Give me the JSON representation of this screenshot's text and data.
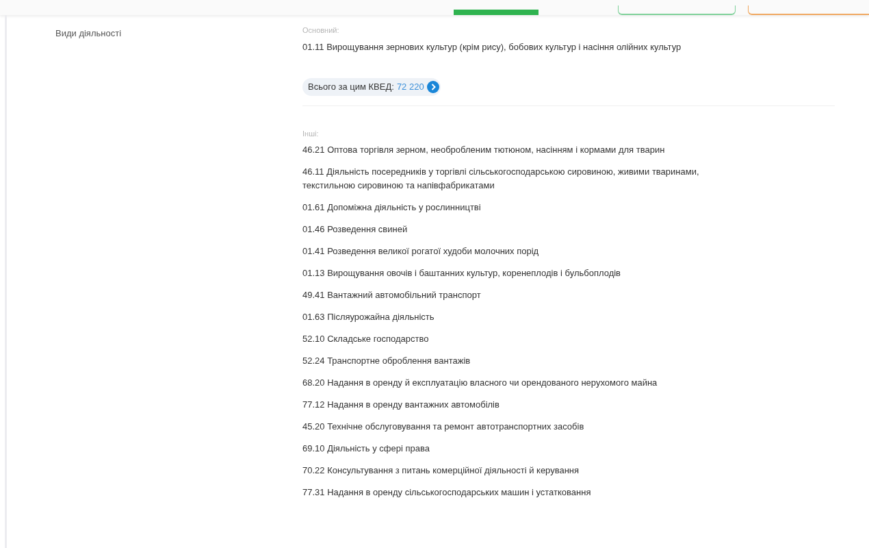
{
  "section_label": "Види діяльності",
  "primary": {
    "heading": "Основний:",
    "activity": "01.11 Вирощування зернових культур (крім рису), бобових культур і насіння олійних культур",
    "total_label": "Всього за цим КВЕД:",
    "total_link": "72 220"
  },
  "others": {
    "heading": "Інші:",
    "items": [
      "46.21 Оптова торгівля зерном, необробленим тютюном, насінням і кормами для тварин",
      "46.11 Діяльність посередників у торгівлі сільськогосподарською сировиною, живими тваринами, текстильною сировиною та напівфабрикатами",
      "01.61 Допоміжна діяльність у рослинництві",
      "01.46 Розведення свиней",
      "01.41 Розведення великої рогатої худоби молочних порід",
      "01.13 Вирощування овочів і баштанних культур, коренеплодів і бульбоплодів",
      "49.41 Вантажний автомобільний транспорт",
      "01.63 Післяурожайна діяльність",
      "52.10 Складське господарство",
      "52.24 Транспортне оброблення вантажів",
      "68.20 Надання в оренду й експлуатацію власного чи орендованого нерухомого майна",
      "77.12 Надання в оренду вантажних автомобілів",
      "45.20 Технічне обслуговування та ремонт автотранспортних засобів",
      "69.10 Діяльність у сфері права",
      "70.22 Консультування з питань комерційної діяльності й керування",
      "77.31 Надання в оренду сільськогосподарських машин і устатковання"
    ]
  }
}
